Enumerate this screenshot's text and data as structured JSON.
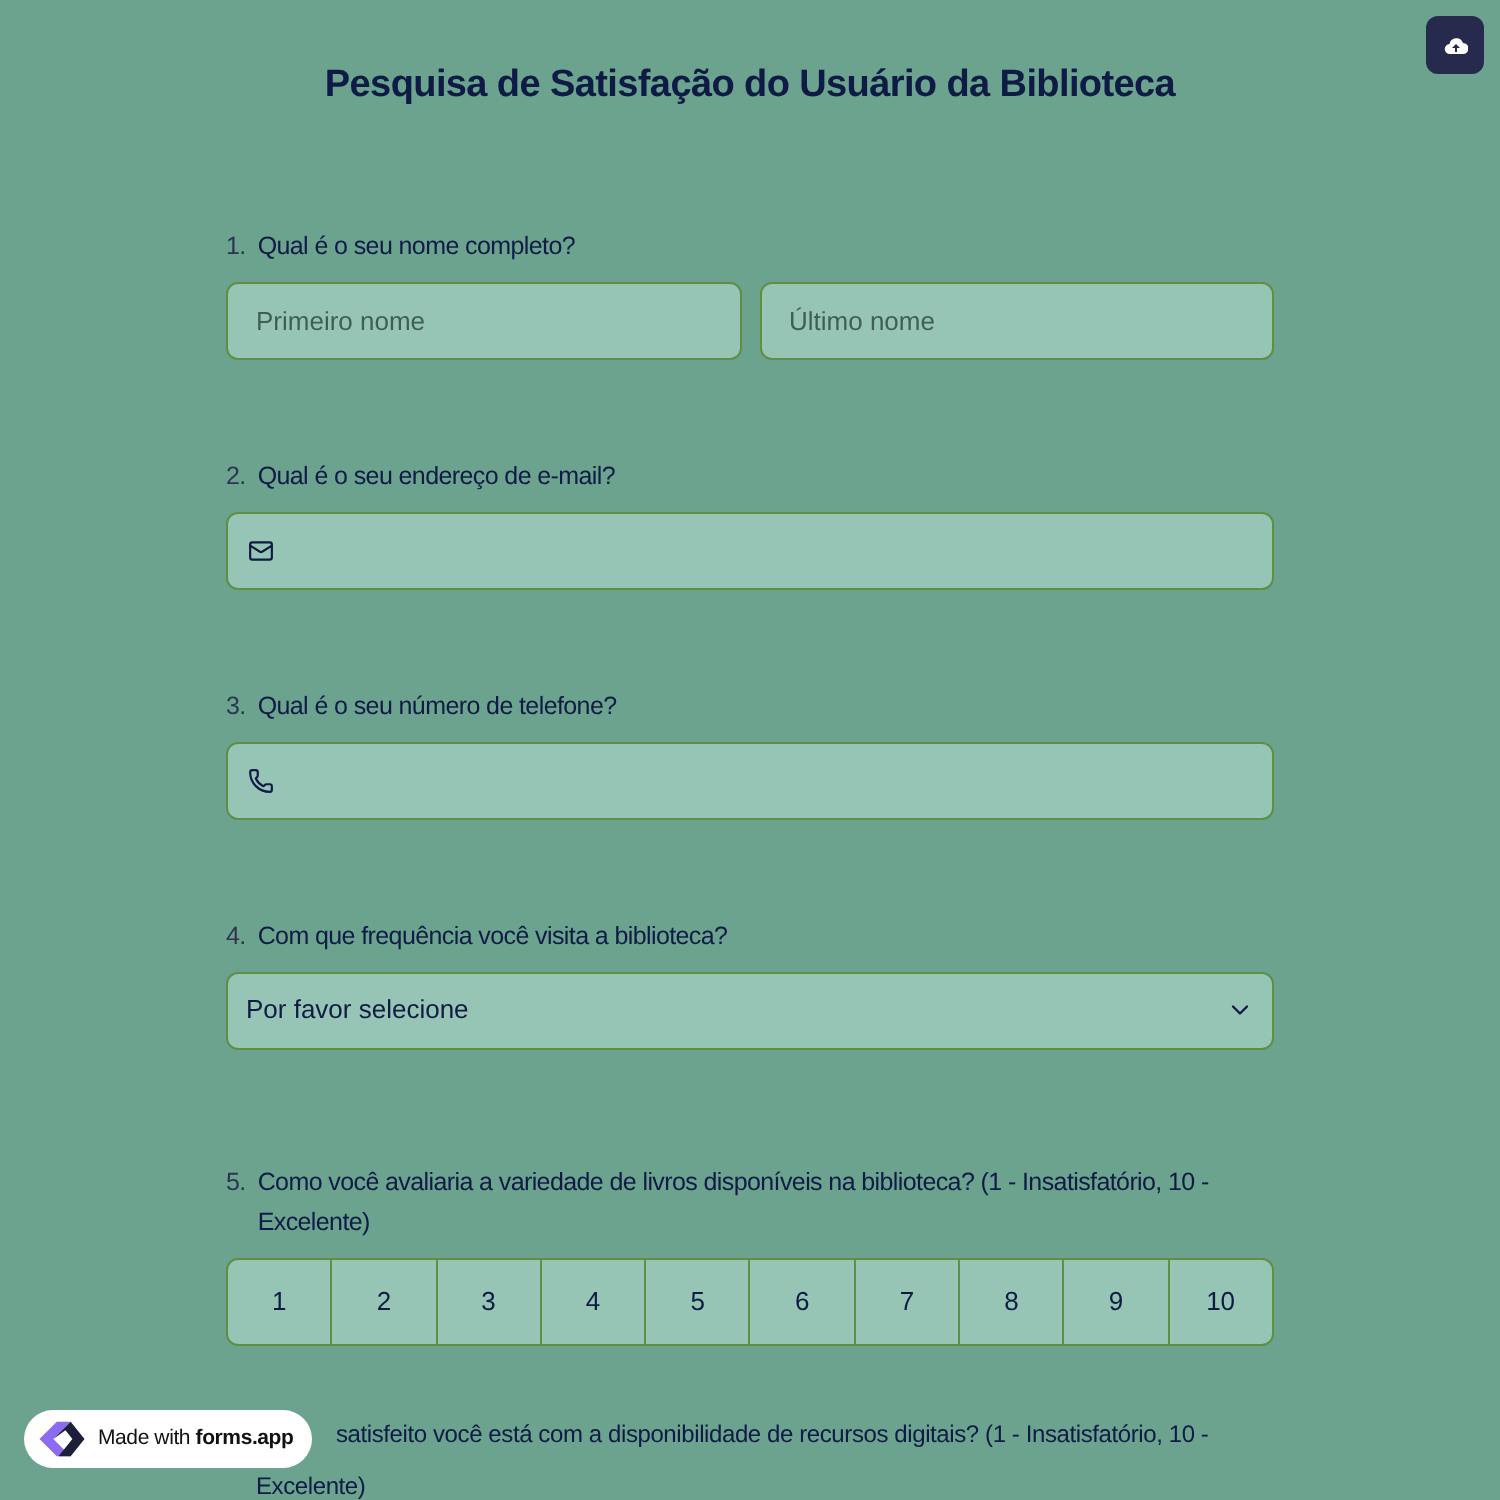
{
  "title": "Pesquisa de Satisfação do Usuário da Biblioteca",
  "questions": [
    {
      "kind": "name",
      "number": "1.",
      "label": "Qual é o seu nome completo?",
      "fields": [
        {
          "placeholder": "Primeiro nome"
        },
        {
          "placeholder": "Último nome"
        }
      ]
    },
    {
      "kind": "email",
      "number": "2.",
      "label": "Qual é o seu endereço de e-mail?"
    },
    {
      "kind": "phone",
      "number": "3.",
      "label": "Qual é o seu número de telefone?"
    },
    {
      "kind": "select",
      "number": "4.",
      "label": "Com que frequência você visita a biblioteca?",
      "value": "Por favor selecione"
    },
    {
      "kind": "scale",
      "number": "5.",
      "label": "Como você avaliaria a variedade de livros disponíveis na biblioteca? (1 - Insatisfatório, 10 - Excelente)",
      "options": [
        "1",
        "2",
        "3",
        "4",
        "5",
        "6",
        "7",
        "8",
        "9",
        "10"
      ]
    },
    {
      "kind": "partial",
      "lines": [
        "satisfeito você está com a disponibilidade de recursos digitais? (1 - Insatisfatório, 10 -",
        "Excelente)"
      ]
    }
  ],
  "badge": {
    "text": "Made with **forms.app**"
  }
}
